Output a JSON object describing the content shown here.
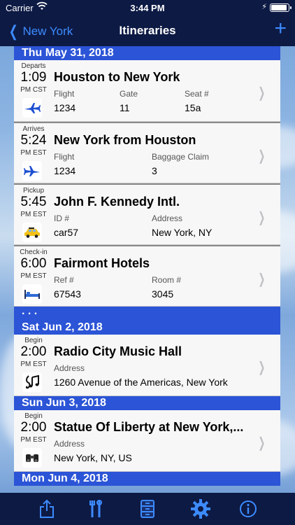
{
  "status": {
    "carrier": "Carrier",
    "time": "3:44 PM"
  },
  "nav": {
    "back_label": "New York",
    "title": "Itineraries",
    "add_label": "+"
  },
  "sections": [
    {
      "date": "Thu May 31, 2018",
      "items": [
        {
          "label": "Departs",
          "time": "1:09",
          "zone": "PM CST",
          "icon": "airplane-icon",
          "title": "Houston to New York",
          "fields": [
            {
              "name": "Flight",
              "value": "1234"
            },
            {
              "name": "Gate",
              "value": "11"
            },
            {
              "name": "Seat #",
              "value": "15a"
            }
          ]
        },
        {
          "label": "Arrives",
          "time": "5:24",
          "zone": "PM  EST",
          "icon": "airplane-icon",
          "title": "New York from Houston",
          "fields": [
            {
              "name": "Flight",
              "value": "1234"
            },
            {
              "name": "Baggage Claim",
              "value": "3"
            }
          ]
        },
        {
          "label": "Pickup",
          "time": "5:45",
          "zone": "PM EST",
          "icon": "taxi-icon",
          "title": "John F. Kennedy Intl.",
          "fields": [
            {
              "name": "ID #",
              "value": "car57"
            },
            {
              "name": "Address",
              "value": "New York, NY"
            }
          ]
        },
        {
          "label": "Check-in",
          "time": "6:00",
          "zone": "PM EST",
          "icon": "bed-icon",
          "title": "Fairmont Hotels",
          "fields": [
            {
              "name": "Ref #",
              "value": "67543"
            },
            {
              "name": "Room #",
              "value": "3045"
            }
          ]
        }
      ]
    },
    {
      "ellipsis": ". . ."
    },
    {
      "date": "Sat Jun 2, 2018",
      "items": [
        {
          "label": "Begin",
          "time": "2:00",
          "zone": "PM EST",
          "icon": "music-icon",
          "title": "Radio City Music Hall",
          "fields": [
            {
              "name": "Address",
              "value": "1260 Avenue of the Americas, New York"
            }
          ]
        }
      ]
    },
    {
      "date": "Sun Jun 3, 2018",
      "items": [
        {
          "label": "Begin",
          "time": "2:00",
          "zone": "PM EST",
          "icon": "binoculars-icon",
          "title": "Statue Of Liberty at New York,...",
          "fields": [
            {
              "name": "Address",
              "value": "New York, NY, US"
            }
          ]
        }
      ]
    },
    {
      "date": "Mon Jun 4, 2018"
    }
  ],
  "tabbar": [
    {
      "icon": "share-icon"
    },
    {
      "icon": "tools-icon"
    },
    {
      "icon": "cabinet-icon"
    },
    {
      "icon": "gear-icon"
    },
    {
      "icon": "info-icon"
    }
  ],
  "colors": {
    "bar": "#0d1a44",
    "accent": "#3d8bff",
    "section": "#2b54d6"
  }
}
